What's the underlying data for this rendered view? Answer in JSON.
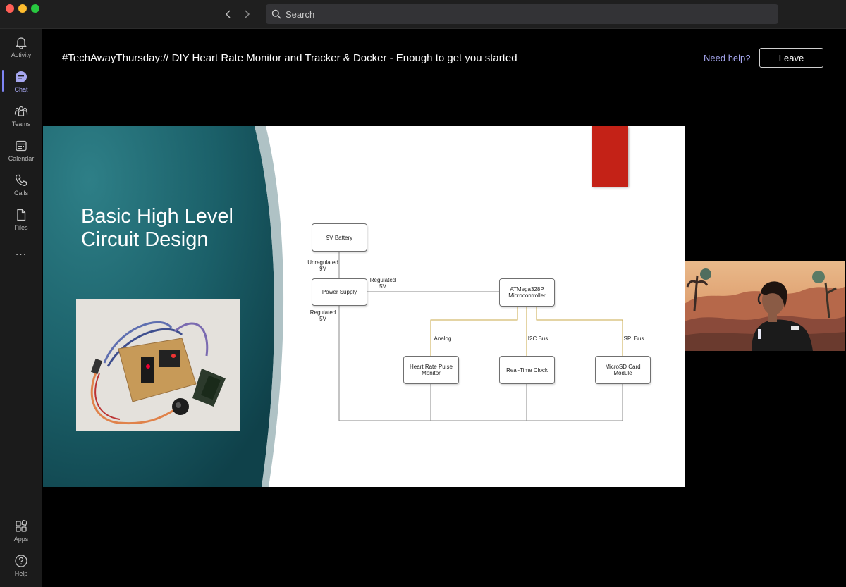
{
  "search": {
    "placeholder": "Search"
  },
  "sidebar": {
    "items": [
      {
        "label": "Activity",
        "icon": "bell-icon"
      },
      {
        "label": "Chat",
        "icon": "chat-icon",
        "active": true
      },
      {
        "label": "Teams",
        "icon": "teams-icon"
      },
      {
        "label": "Calendar",
        "icon": "calendar-icon"
      },
      {
        "label": "Calls",
        "icon": "phone-icon"
      },
      {
        "label": "Files",
        "icon": "file-icon"
      }
    ],
    "more_label": "...",
    "bottom_items": [
      {
        "label": "Apps",
        "icon": "apps-icon"
      },
      {
        "label": "Help",
        "icon": "help-icon"
      }
    ]
  },
  "meeting": {
    "title": "#TechAwayThursday:// DIY Heart Rate Monitor and Tracker & Docker - Enough to get you started",
    "need_help": "Need help?",
    "leave": "Leave"
  },
  "slide": {
    "heading": "Basic High Level Circuit Design",
    "diagram": {
      "nodes": {
        "battery": "9V Battery",
        "power_supply": "Power Supply",
        "mcu_line1": "ATMega328P",
        "mcu_line2": "Microcontroller",
        "hr_line1": "Heart Rate Pulse",
        "hr_line2": "Monitor",
        "rtc": "Real-Time Clock",
        "sd_line1": "MicroSD Card",
        "sd_line2": "Module"
      },
      "labels": {
        "unregulated_1": "Unregulated",
        "unregulated_2": "9V",
        "regulated_a1": "Regulated",
        "regulated_a2": "5V",
        "regulated_b1": "Regulated",
        "regulated_b2": "5V",
        "analog": "Analog",
        "i2c": "I2C Bus",
        "spi": "SPI Bus"
      }
    }
  },
  "colors": {
    "accent": "#7f85f5",
    "slide_red": "#c42217",
    "slide_teal": "#1f6a73",
    "bus_line": "#c9a84a"
  }
}
